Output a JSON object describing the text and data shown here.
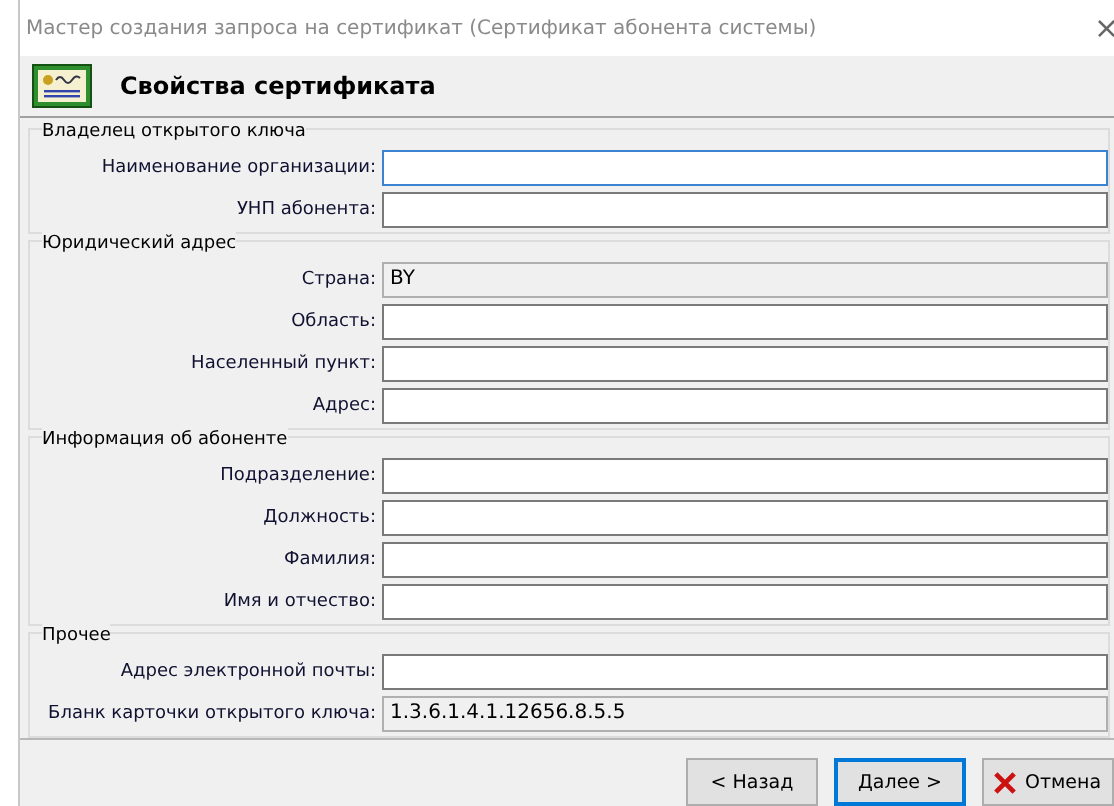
{
  "window": {
    "title": "Мастер создания запроса на сертификат (Сертификат абонента системы)",
    "close": "×"
  },
  "header": {
    "title": "Свойства сертификата"
  },
  "groups": [
    {
      "title": "Владелец открытого ключа",
      "fields": [
        {
          "label": "Наименование организации:",
          "disabled": false,
          "focused": true
        },
        {
          "label": "УНП абонента:",
          "disabled": false,
          "focused": false
        }
      ]
    },
    {
      "title": "Юридический адрес",
      "fields": [
        {
          "label": "Страна:",
          "value": "BY",
          "disabled": true,
          "focused": false
        },
        {
          "label": "Область:",
          "disabled": false,
          "focused": false
        },
        {
          "label": "Населенный пункт:",
          "disabled": false,
          "focused": false
        },
        {
          "label": "Адрес:",
          "disabled": false,
          "focused": false
        }
      ]
    },
    {
      "title": "Информация об абоненте",
      "fields": [
        {
          "label": "Подразделение:",
          "disabled": false,
          "focused": false
        },
        {
          "label": "Должность:",
          "disabled": false,
          "focused": false
        },
        {
          "label": "Фамилия:",
          "disabled": false,
          "focused": false
        },
        {
          "label": "Имя и отчество:",
          "disabled": false,
          "focused": false
        }
      ]
    },
    {
      "title": "Прочее",
      "fields": [
        {
          "label": "Адрес электронной почты:",
          "disabled": false,
          "focused": false
        },
        {
          "label": "Бланк карточки открытого ключа:",
          "value": "1.3.6.1.4.1.12656.8.5.5",
          "disabled": true,
          "focused": false
        }
      ]
    }
  ],
  "buttons": [
    {
      "label": "< Назад",
      "kind": "plain",
      "selected": false
    },
    {
      "label": "Далее >",
      "kind": "plain",
      "selected": true
    },
    {
      "label": "Отмена",
      "kind": "cancel",
      "selected": false
    }
  ]
}
